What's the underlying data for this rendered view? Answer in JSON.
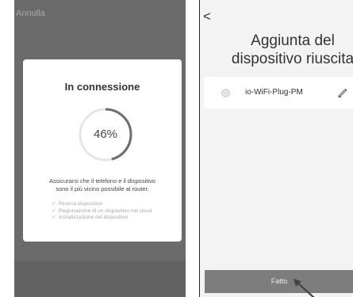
{
  "left_screen": {
    "cancel_label": "Annulla",
    "dialog": {
      "title": "In connessione",
      "progress": 0.46,
      "progress_label": "46%",
      "hint_lines": [
        "Assicurarsi che il telefono e il dispositivo",
        "sono il più vicino possibile al router."
      ],
      "steps": [
        {
          "icon": "check-icon",
          "label": "Ricerca dispositivo"
        },
        {
          "icon": "check-icon",
          "label": "Registrazione di un dispositivo nel cloud"
        },
        {
          "icon": "check-icon",
          "label": "Inizializzazione del dispositivo"
        }
      ]
    },
    "colors": {
      "overlay": "#6b6b6b",
      "ring_track": "#e6e6e6",
      "ring_progress": "#6e6e6e"
    }
  },
  "right_screen": {
    "back_icon": "chevron-left-icon",
    "title_lines": [
      "Aggiunta del",
      "dispositivo riuscita"
    ],
    "device": {
      "name": "io-WiFi-Plug-PM",
      "avatar_icon": "device-avatar-icon",
      "action_icon": "pencil-icon"
    },
    "done_label": "Fatto",
    "colors": {
      "background": "#f3f3f3",
      "button": "#7d7d7d"
    }
  },
  "annotation": {
    "icon": "pointer-arrow-icon",
    "color": "#444444"
  }
}
